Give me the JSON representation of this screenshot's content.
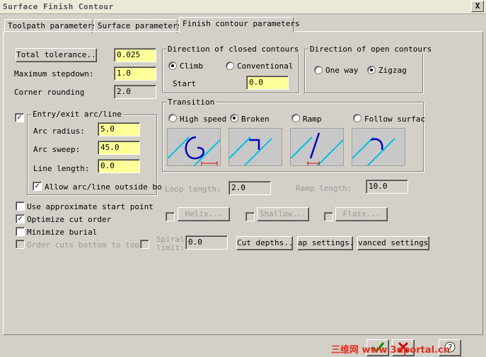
{
  "window": {
    "title": "Surface Finish Contour",
    "close_glyph": "X"
  },
  "tabs": [
    {
      "label": "Toolpath parameters"
    },
    {
      "label": "Surface parameters"
    },
    {
      "label": "Finish contour parameters"
    }
  ],
  "left": {
    "total_tolerance_label": "Total tolerance...",
    "total_tolerance_value": "0.025",
    "max_stepdown_label": "Maximum stepdown:",
    "max_stepdown_value": "1.0",
    "corner_rounding_label": "Corner rounding",
    "corner_rounding_value": "2.0"
  },
  "entry_exit": {
    "label": "Entry/exit arc/line",
    "checked": true,
    "arc_radius_label": "Arc radius:",
    "arc_radius_value": "5.0",
    "arc_sweep_label": "Arc sweep:",
    "arc_sweep_value": "45.0",
    "line_length_label": "Line length:",
    "line_length_value": "0.0",
    "allow_outside_label": "Allow arc/line outside bo",
    "allow_outside_checked": true
  },
  "options": [
    {
      "label": "Use approximate start point",
      "checked": false,
      "disabled": false
    },
    {
      "label": "Optimize cut order",
      "checked": true,
      "disabled": false
    },
    {
      "label": "Minimize burial",
      "checked": false,
      "disabled": false
    },
    {
      "label": "Order cuts bottom to top",
      "checked": false,
      "disabled": true
    }
  ],
  "closed_contours": {
    "title": "Direction of closed contours",
    "climb_label": "Climb",
    "conventional_label": "Conventional",
    "selected": "Climb",
    "start_label": "Start",
    "start_value": "0.0"
  },
  "open_contours": {
    "title": "Direction of open contours",
    "one_way_label": "One way",
    "zigzag_label": "Zigzag",
    "selected": "Zigzag"
  },
  "transition": {
    "title": "Transition",
    "options": [
      {
        "label": "High speed",
        "icon": "high-speed-preview-icon"
      },
      {
        "label": "Broken",
        "icon": "broken-preview-icon"
      },
      {
        "label": "Ramp",
        "icon": "ramp-preview-icon"
      },
      {
        "label": "Follow surfac",
        "icon": "follow-surface-preview-icon"
      }
    ],
    "selected": "Broken"
  },
  "loop_length_label": "Loop length:",
  "loop_length_value": "2.0",
  "ramp_length_label": "Ramp length:",
  "ramp_length_value": "10.0",
  "helix_label": "Helix...",
  "shallow_label": "Shallow...",
  "flats_label": "Flats...",
  "spiral_label_1": "Spiral",
  "spiral_label_2": "limit:",
  "spiral_value": "0.0",
  "cut_depths_label": "Cut depths...",
  "gap_settings_label": "ap settings...",
  "advanced_settings_label": "vanced settings.",
  "watermark": "三维网 www.3dportal.cn",
  "colors": {
    "field_bg": "#ffff99",
    "preview_line": "#00c0e0",
    "preview_path": "#0000c0",
    "preview_marker": "#e00000"
  }
}
